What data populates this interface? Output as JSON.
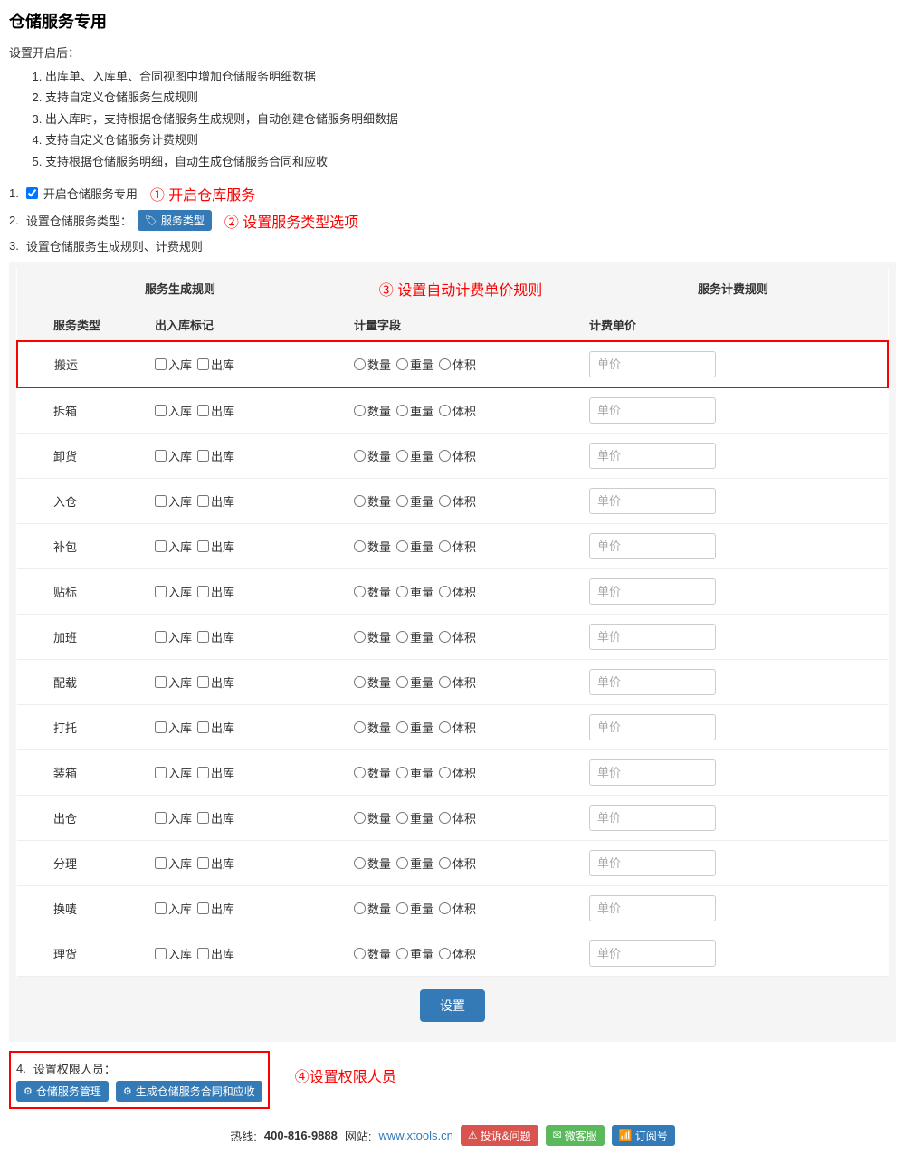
{
  "title": "仓储服务专用",
  "intro": {
    "label": "设置开启后：",
    "items": [
      "出库单、入库单、合同视图中增加仓储服务明细数据",
      "支持自定义仓储服务生成规则",
      "出入库时，支持根据仓储服务生成规则，自动创建仓储服务明细数据",
      "支持自定义仓储服务计费规则",
      "支持根据仓储服务明细，自动生成仓储服务合同和应收"
    ]
  },
  "steps": {
    "s1_num": "1.",
    "s1_label": "开启仓储服务专用",
    "s1_annot": "① 开启仓库服务",
    "s2_num": "2.",
    "s2_label": "设置仓储服务类型：",
    "s2_btn": "服务类型",
    "s2_annot": "② 设置服务类型选项",
    "s3_num": "3.",
    "s3_label": "设置仓储服务生成规则、计费规则",
    "s4_num": "4.",
    "s4_label": "设置权限人员：",
    "s4_annot": "④设置权限人员",
    "s4_btn1": "仓储服务管理",
    "s4_btn2": "生成仓储服务合同和应收"
  },
  "table": {
    "group1": "服务生成规则",
    "group_annot": "③ 设置自动计费单价规则",
    "group2": "服务计费规则",
    "col_type": "服务类型",
    "col_mark": "出入库标记",
    "col_field": "计量字段",
    "col_price": "计费单价",
    "mark_in": "入库",
    "mark_out": "出库",
    "field_qty": "数量",
    "field_weight": "重量",
    "field_vol": "体积",
    "price_placeholder": "单价",
    "rows": [
      {
        "type": "搬运",
        "highlight": true
      },
      {
        "type": "拆箱"
      },
      {
        "type": "卸货"
      },
      {
        "type": "入仓"
      },
      {
        "type": "补包"
      },
      {
        "type": "贴标"
      },
      {
        "type": "加班"
      },
      {
        "type": "配载"
      },
      {
        "type": "打托"
      },
      {
        "type": "装箱"
      },
      {
        "type": "出仓"
      },
      {
        "type": "分理"
      },
      {
        "type": "换唛"
      },
      {
        "type": "理货"
      }
    ],
    "submit": "设置"
  },
  "footer": {
    "hotline_label": "热线:",
    "hotline": "400-816-9888",
    "site_label": "网站:",
    "site": "www.xtools.cn",
    "badge1": "投诉&问题",
    "badge2": "微客服",
    "badge3": "订阅号"
  }
}
